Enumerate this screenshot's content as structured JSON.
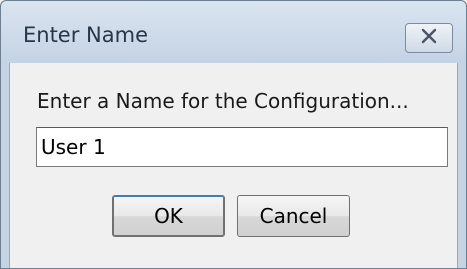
{
  "dialog": {
    "title": "Enter Name",
    "close_icon": "close-icon",
    "prompt": "Enter a Name for the Configuration...",
    "name_value": "User 1",
    "ok_label": "OK",
    "cancel_label": "Cancel"
  },
  "colors": {
    "titlebar": "#c4d3e4",
    "client": "#f0f0f0",
    "default_button_border": "#3c7fb1"
  }
}
